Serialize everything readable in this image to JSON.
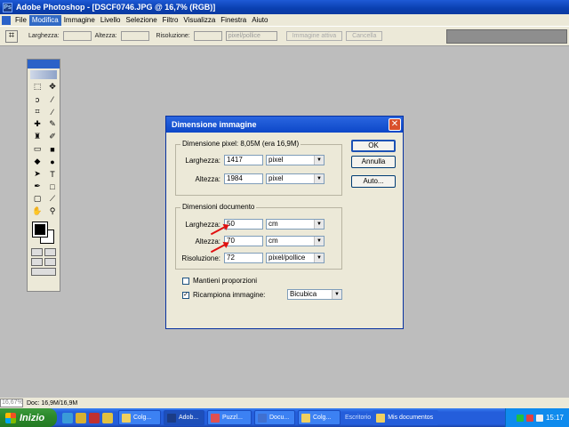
{
  "app": {
    "title": "Adobe Photoshop - [DSCF0746.JPG @ 16,7% (RGB)]"
  },
  "menu": [
    "File",
    "Modifica",
    "Immagine",
    "Livello",
    "Selezione",
    "Filtro",
    "Visualizza",
    "Finestra",
    "Aiuto"
  ],
  "menu_active": "Modifica",
  "options": {
    "width_label": "Larghezza:",
    "height_label": "Altezza:",
    "resolution_label": "Risoluzione:",
    "units_value": "pixel/pollice",
    "front_image_button": "Immagine attiva",
    "clear_button": "Cancella"
  },
  "dialog": {
    "title": "Dimensione immagine",
    "pixel_group": {
      "legend": "Dimensione pixel:",
      "legend_value": "8,05M (era 16,9M)",
      "width_label": "Larghezza:",
      "width_value": "1417",
      "width_unit": "pixel",
      "height_label": "Altezza:",
      "height_value": "1984",
      "height_unit": "pixel"
    },
    "doc_group": {
      "legend": "Dimensioni documento",
      "width_label": "Larghezza:",
      "width_value": "50",
      "width_unit": "cm",
      "height_label": "Altezza:",
      "height_value": "70",
      "height_unit": "cm",
      "res_label": "Risoluzione:",
      "res_value": "72",
      "res_unit": "pixel/pollice"
    },
    "constrain_label": "Mantieni proporzioni",
    "constrain_checked": false,
    "resample_label": "Ricampiona immagine:",
    "resample_checked": true,
    "resample_value": "Bicubica",
    "buttons": {
      "ok": "OK",
      "cancel": "Annulla",
      "auto": "Auto..."
    }
  },
  "status": {
    "zoom": "16,67%",
    "doc": "Doc: 16,9M/16,9M"
  },
  "taskbar": {
    "start": "Inizio",
    "tasks": [
      "Colg...",
      "Adob...",
      "Puzzl...",
      "Docu...",
      "Colg..."
    ],
    "active_task": 1,
    "address_label": "Escritorio",
    "my_docs": "Mis documentos",
    "clock": "15:17"
  },
  "colors": {
    "title_blue": "#0a3fb0",
    "taskbar_blue": "#245edb",
    "start_green": "#2d8a2d",
    "dialog_bg": "#ece9d8",
    "annotation_red": "#e01010"
  }
}
